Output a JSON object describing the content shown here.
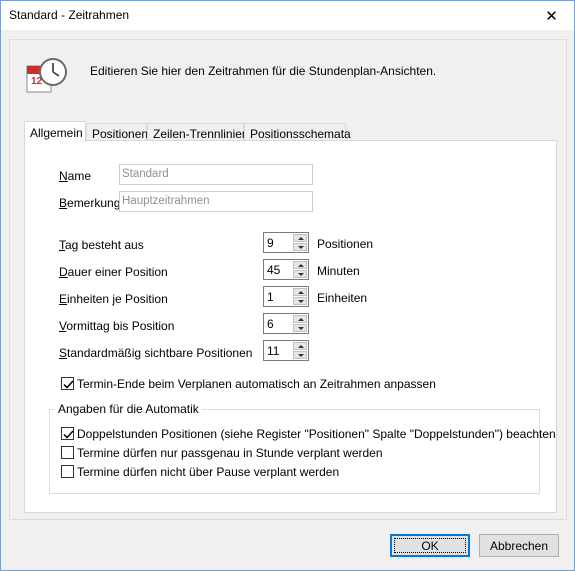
{
  "window": {
    "title": "Standard - Zeitrahmen",
    "close_icon": "close-icon"
  },
  "header": {
    "icon": "calendar-clock-icon",
    "text": "Editieren Sie hier den Zeitrahmen für die Stundenplan-Ansichten."
  },
  "tabs": [
    {
      "label": "Allgemein",
      "active": true
    },
    {
      "label": "Positionen"
    },
    {
      "label": "Zeilen-Trennlinien"
    },
    {
      "label": "Positionsschemata"
    }
  ],
  "form": {
    "name_label": "Name",
    "name_value": "Standard",
    "bemerkung_label": "Bemerkung",
    "bemerkung_value": "Hauptzeitrahmen",
    "tag_label": "Tag besteht aus",
    "tag_value": "9",
    "tag_unit": "Positionen",
    "dauer_label": "Dauer einer Position",
    "dauer_value": "45",
    "dauer_unit": "Minuten",
    "einheiten_label": "Einheiten je Position",
    "einheiten_value": "1",
    "einheiten_unit": "Einheiten",
    "vormittag_label": "Vormittag bis Position",
    "vormittag_value": "6",
    "sichtbar_label": "Standardmäßig sichtbare Positionen",
    "sichtbar_value": "11",
    "termin_ende_label": "Termin-Ende beim Verplanen automatisch an Zeitrahmen anpassen",
    "termin_ende_checked": true
  },
  "automatik": {
    "title": "Angaben für die Automatik",
    "doppelstunden_label": "Doppelstunden Positionen (siehe Register \"Positionen\" Spalte \"Doppelstunden\") beachten",
    "doppelstunden_checked": true,
    "passgenau_label": "Termine dürfen nur passgenau in Stunde verplant werden",
    "passgenau_checked": false,
    "pause_label": "Termine dürfen nicht über Pause verplant werden",
    "pause_checked": false
  },
  "buttons": {
    "ok": "OK",
    "cancel": "Abbrechen"
  }
}
